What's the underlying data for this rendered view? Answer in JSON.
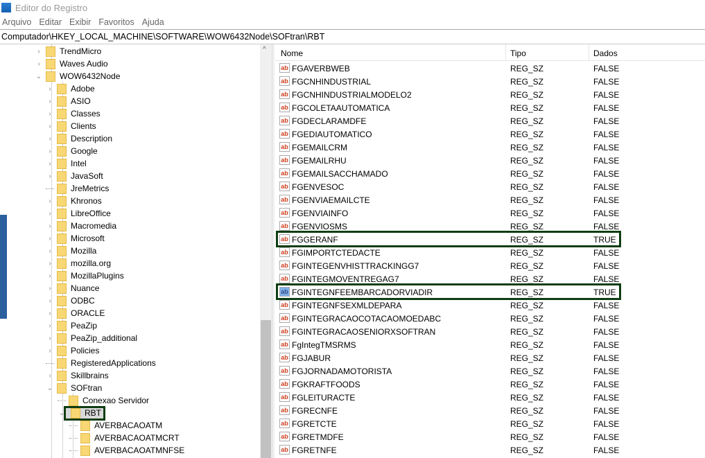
{
  "window": {
    "title": "Editor do Registro"
  },
  "menu": [
    "Arquivo",
    "Editar",
    "Exibir",
    "Favoritos",
    "Ajuda"
  ],
  "address": "Computador\\HKEY_LOCAL_MACHINE\\SOFTWARE\\WOW6432Node\\SOFtran\\RBT",
  "tree": [
    {
      "label": "TrendMicro",
      "level": 0,
      "state": "collapsed"
    },
    {
      "label": "Waves Audio",
      "level": 0,
      "state": "collapsed"
    },
    {
      "label": "WOW6432Node",
      "level": 0,
      "state": "expanded"
    },
    {
      "label": "Adobe",
      "level": 1,
      "state": "collapsed"
    },
    {
      "label": "ASIO",
      "level": 1,
      "state": "collapsed"
    },
    {
      "label": "Classes",
      "level": 1,
      "state": "collapsed"
    },
    {
      "label": "Clients",
      "level": 1,
      "state": "collapsed"
    },
    {
      "label": "Description",
      "level": 1,
      "state": "collapsed"
    },
    {
      "label": "Google",
      "level": 1,
      "state": "collapsed"
    },
    {
      "label": "Intel",
      "level": 1,
      "state": "collapsed"
    },
    {
      "label": "JavaSoft",
      "level": 1,
      "state": "collapsed"
    },
    {
      "label": "JreMetrics",
      "level": 1,
      "state": "leaf"
    },
    {
      "label": "Khronos",
      "level": 1,
      "state": "collapsed"
    },
    {
      "label": "LibreOffice",
      "level": 1,
      "state": "collapsed"
    },
    {
      "label": "Macromedia",
      "level": 1,
      "state": "collapsed"
    },
    {
      "label": "Microsoft",
      "level": 1,
      "state": "collapsed"
    },
    {
      "label": "Mozilla",
      "level": 1,
      "state": "collapsed"
    },
    {
      "label": "mozilla.org",
      "level": 1,
      "state": "collapsed"
    },
    {
      "label": "MozillaPlugins",
      "level": 1,
      "state": "collapsed"
    },
    {
      "label": "Nuance",
      "level": 1,
      "state": "collapsed"
    },
    {
      "label": "ODBC",
      "level": 1,
      "state": "collapsed"
    },
    {
      "label": "ORACLE",
      "level": 1,
      "state": "collapsed"
    },
    {
      "label": "PeaZip",
      "level": 1,
      "state": "collapsed"
    },
    {
      "label": "PeaZip_additional",
      "level": 1,
      "state": "collapsed"
    },
    {
      "label": "Policies",
      "level": 1,
      "state": "collapsed"
    },
    {
      "label": "RegisteredApplications",
      "level": 1,
      "state": "leaf"
    },
    {
      "label": "Skillbrains",
      "level": 1,
      "state": "collapsed"
    },
    {
      "label": "SOFtran",
      "level": 1,
      "state": "expanded"
    },
    {
      "label": "Conexao Servidor",
      "level": 2,
      "state": "leaf"
    },
    {
      "label": "RBT",
      "level": 2,
      "state": "expanded",
      "selected": true
    },
    {
      "label": "AVERBACAOATM",
      "level": 3,
      "state": "leaf"
    },
    {
      "label": "AVERBACAOATMCRT",
      "level": 3,
      "state": "leaf"
    },
    {
      "label": "AVERBACAOATMNFSE",
      "level": 3,
      "state": "leaf"
    }
  ],
  "columns": {
    "name": "Nome",
    "type": "Tipo",
    "data": "Dados"
  },
  "values": [
    {
      "name": "FGAVERBWEB",
      "type": "REG_SZ",
      "data": "FALSE"
    },
    {
      "name": "FGCNHINDUSTRIAL",
      "type": "REG_SZ",
      "data": "FALSE"
    },
    {
      "name": "FGCNHINDUSTRIALMODELO2",
      "type": "REG_SZ",
      "data": "FALSE"
    },
    {
      "name": "FGCOLETAAUTOMATICA",
      "type": "REG_SZ",
      "data": "FALSE"
    },
    {
      "name": "FGDECLARAMDFE",
      "type": "REG_SZ",
      "data": "FALSE"
    },
    {
      "name": "FGEDIAUTOMATICO",
      "type": "REG_SZ",
      "data": "FALSE"
    },
    {
      "name": "FGEMAILCRM",
      "type": "REG_SZ",
      "data": "FALSE"
    },
    {
      "name": "FGEMAILRHU",
      "type": "REG_SZ",
      "data": "FALSE"
    },
    {
      "name": "FGEMAILSACCHAMADO",
      "type": "REG_SZ",
      "data": "FALSE"
    },
    {
      "name": "FGENVESOC",
      "type": "REG_SZ",
      "data": "FALSE"
    },
    {
      "name": "FGENVIAEMAILCTE",
      "type": "REG_SZ",
      "data": "FALSE"
    },
    {
      "name": "FGENVIAINFO",
      "type": "REG_SZ",
      "data": "FALSE"
    },
    {
      "name": "FGENVIOSMS",
      "type": "REG_SZ",
      "data": "FALSE"
    },
    {
      "name": "FGGERANF",
      "type": "REG_SZ",
      "data": "TRUE",
      "highlighted": true
    },
    {
      "name": "FGIMPORTCTEDACTE",
      "type": "REG_SZ",
      "data": "FALSE"
    },
    {
      "name": "FGINTEGENVHISTTRACKINGG7",
      "type": "REG_SZ",
      "data": "FALSE"
    },
    {
      "name": "FGINTEGMOVENTREGAG7",
      "type": "REG_SZ",
      "data": "FALSE"
    },
    {
      "name": "FGINTEGNFEEMBARCADORVIADIR",
      "type": "REG_SZ",
      "data": "TRUE",
      "highlighted": true,
      "icon": "selected"
    },
    {
      "name": "FGINTEGNFSEXMLDEPARA",
      "type": "REG_SZ",
      "data": "FALSE"
    },
    {
      "name": "FGINTEGRACAOCOTACAOMOEDABC",
      "type": "REG_SZ",
      "data": "FALSE"
    },
    {
      "name": "FGINTEGRACAOSENIORXSOFTRAN",
      "type": "REG_SZ",
      "data": "FALSE"
    },
    {
      "name": "FgIntegTMSRMS",
      "type": "REG_SZ",
      "data": "FALSE"
    },
    {
      "name": "FGJABUR",
      "type": "REG_SZ",
      "data": "FALSE"
    },
    {
      "name": "FGJORNADAMOTORISTA",
      "type": "REG_SZ",
      "data": "FALSE"
    },
    {
      "name": "FGKRAFTFOODS",
      "type": "REG_SZ",
      "data": "FALSE"
    },
    {
      "name": "FGLEITURACTE",
      "type": "REG_SZ",
      "data": "FALSE"
    },
    {
      "name": "FGRECNFE",
      "type": "REG_SZ",
      "data": "FALSE"
    },
    {
      "name": "FGRETCTE",
      "type": "REG_SZ",
      "data": "FALSE"
    },
    {
      "name": "FGRETMDFE",
      "type": "REG_SZ",
      "data": "FALSE"
    },
    {
      "name": "FGRETNFE",
      "type": "REG_SZ",
      "data": "FALSE"
    }
  ],
  "highlight_color": "#0e3d12"
}
